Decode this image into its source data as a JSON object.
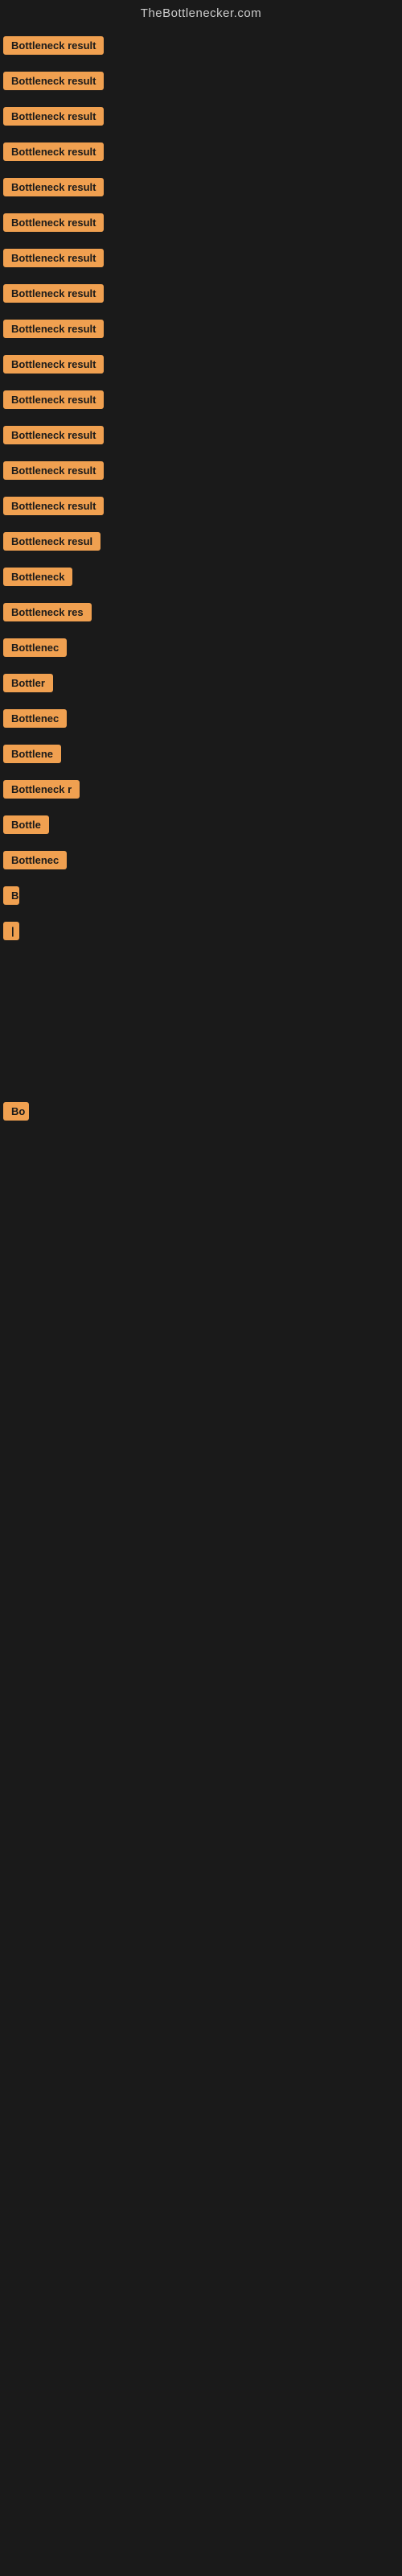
{
  "site": {
    "title": "TheBottlenecker.com"
  },
  "items": [
    {
      "id": 1,
      "label": "Bottleneck result"
    },
    {
      "id": 2,
      "label": "Bottleneck result"
    },
    {
      "id": 3,
      "label": "Bottleneck result"
    },
    {
      "id": 4,
      "label": "Bottleneck result"
    },
    {
      "id": 5,
      "label": "Bottleneck result"
    },
    {
      "id": 6,
      "label": "Bottleneck result"
    },
    {
      "id": 7,
      "label": "Bottleneck result"
    },
    {
      "id": 8,
      "label": "Bottleneck result"
    },
    {
      "id": 9,
      "label": "Bottleneck result"
    },
    {
      "id": 10,
      "label": "Bottleneck result"
    },
    {
      "id": 11,
      "label": "Bottleneck result"
    },
    {
      "id": 12,
      "label": "Bottleneck result"
    },
    {
      "id": 13,
      "label": "Bottleneck result"
    },
    {
      "id": 14,
      "label": "Bottleneck result"
    },
    {
      "id": 15,
      "label": "Bottleneck resul"
    },
    {
      "id": 16,
      "label": "Bottleneck"
    },
    {
      "id": 17,
      "label": "Bottleneck res"
    },
    {
      "id": 18,
      "label": "Bottlenec"
    },
    {
      "id": 19,
      "label": "Bottler"
    },
    {
      "id": 20,
      "label": "Bottlenec"
    },
    {
      "id": 21,
      "label": "Bottlene"
    },
    {
      "id": 22,
      "label": "Bottleneck r"
    },
    {
      "id": 23,
      "label": "Bottle"
    },
    {
      "id": 24,
      "label": "Bottlenec"
    },
    {
      "id": 25,
      "label": "B"
    },
    {
      "id": 26,
      "label": "|"
    }
  ],
  "last_item": {
    "label": "Bo"
  },
  "colors": {
    "background": "#1a1a1a",
    "badge_bg": "#f0a050",
    "badge_text": "#1a1a1a",
    "header_text": "#cccccc"
  }
}
